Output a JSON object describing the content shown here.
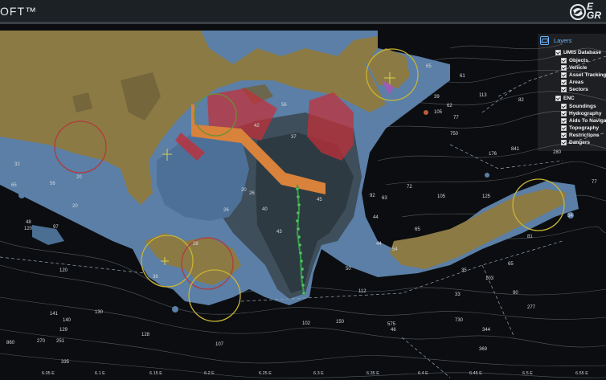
{
  "app": {
    "title": "OFT™",
    "logo_text_1": "E",
    "logo_text_2": "GR"
  },
  "layers_panel": {
    "title": "Layers",
    "groups": [
      {
        "label": "UMIS Database",
        "checked": true,
        "items": [
          {
            "label": "Objects",
            "checked": true
          },
          {
            "label": "Vehicle",
            "checked": true
          },
          {
            "label": "Asset Tracking",
            "checked": true
          },
          {
            "label": "Areas",
            "checked": true
          },
          {
            "label": "Sectors",
            "checked": true
          }
        ]
      },
      {
        "label": "ENC",
        "checked": true,
        "items": [
          {
            "label": "Soundings",
            "checked": true
          },
          {
            "label": "Hydrography",
            "checked": true
          },
          {
            "label": "Aids To Navigati",
            "checked": true
          },
          {
            "label": "Topography",
            "checked": true
          },
          {
            "label": "Restrictions",
            "checked": true
          },
          {
            "label": "Dangers",
            "checked": true
          }
        ]
      }
    ]
  },
  "map": {
    "colors": {
      "land": "#8c7a45",
      "shallow": "#5b7fa6",
      "mid": "#4b6e93",
      "deep": "#33434f",
      "sea": "#0b0d10",
      "restricted": "#c0303a"
    },
    "depth_labels": [
      "32",
      "65",
      "56",
      "20",
      "20",
      "97",
      "120",
      "120",
      "141",
      "140",
      "130",
      "129",
      "128",
      "270",
      "251",
      "860",
      "335",
      "107",
      "102",
      "20",
      "26",
      "26",
      "37",
      "40",
      "43",
      "45",
      "50",
      "56",
      "42",
      "46",
      "72",
      "44",
      "44",
      "105",
      "65",
      "63",
      "54",
      "36",
      "35",
      "33",
      "103",
      "90",
      "277",
      "730",
      "344",
      "369",
      "575",
      "150",
      "112",
      "92",
      "65",
      "61",
      "39",
      "62",
      "77",
      "113",
      "82",
      "176",
      "841",
      "750",
      "280",
      "77",
      "125",
      "81",
      "65",
      "54",
      "105",
      "48",
      "28"
    ],
    "longitude_ticks": [
      "6.05 E",
      "6.1 E",
      "6.15 E",
      "6.2 E",
      "6.25 E",
      "6.3 E",
      "6.35 E",
      "6.4 E",
      "6.45 E",
      "6.5 E",
      "6.55 E"
    ],
    "vehicle_track_name": "vehicle-track"
  }
}
